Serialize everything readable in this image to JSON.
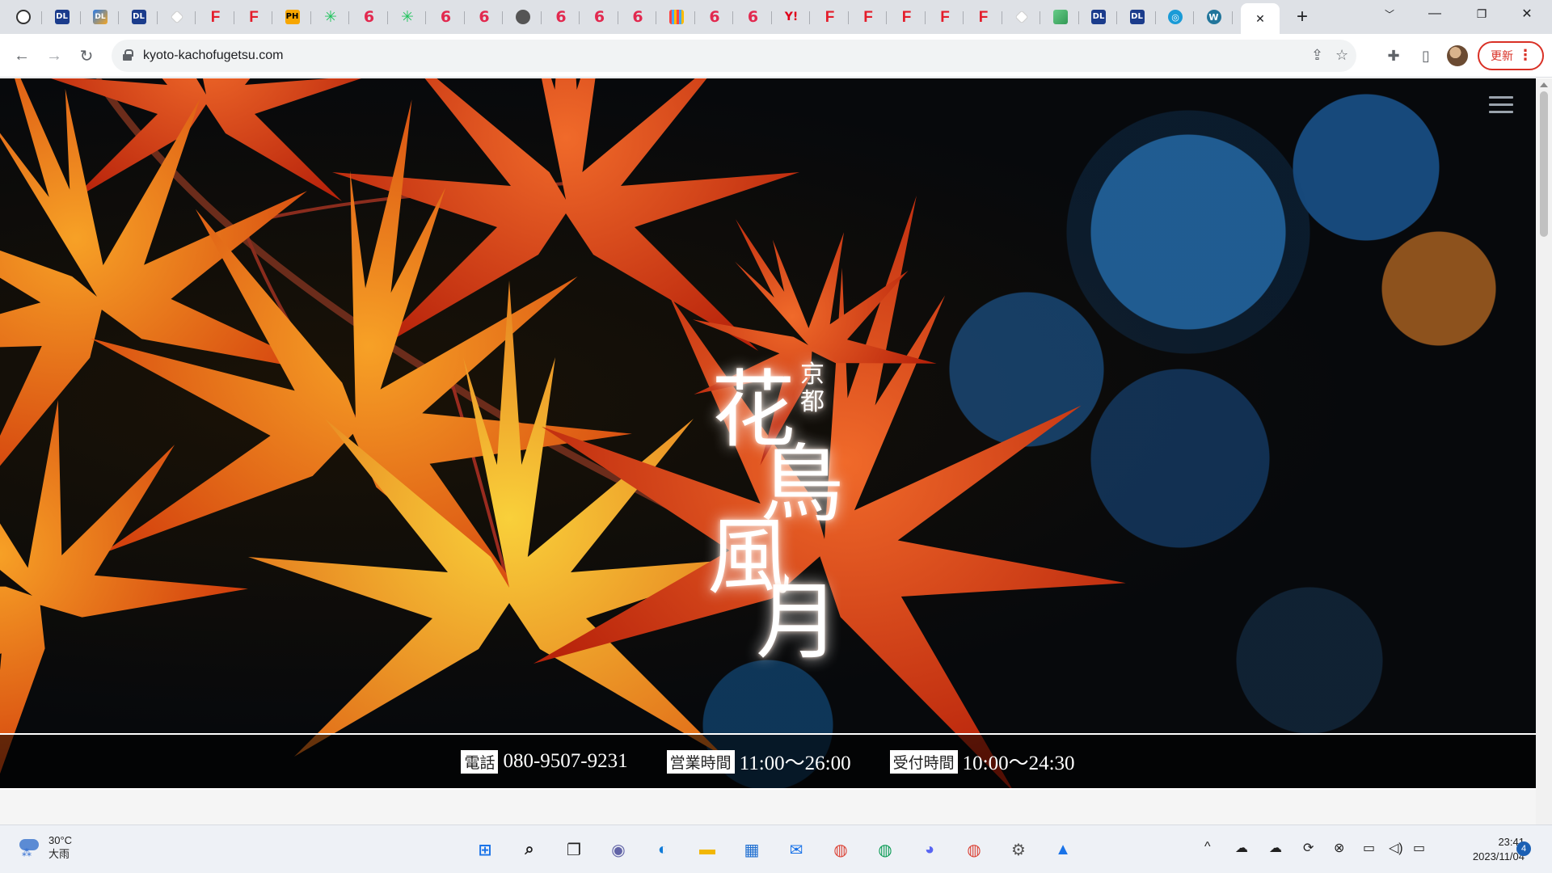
{
  "browser": {
    "tabs": [
      {
        "icon": "github-icon",
        "kind": "gh",
        "glyph": ""
      },
      {
        "icon": "dl-icon",
        "kind": "dl",
        "glyph": "DL"
      },
      {
        "icon": "dl-color-icon",
        "kind": "dlc",
        "glyph": "DL"
      },
      {
        "icon": "dl-icon",
        "kind": "dl",
        "glyph": "DL"
      },
      {
        "icon": "diamond-icon",
        "kind": "diamond",
        "glyph": ""
      },
      {
        "icon": "fanza-icon",
        "kind": "f",
        "glyph": "F"
      },
      {
        "icon": "fanza-icon",
        "kind": "f",
        "glyph": "F"
      },
      {
        "icon": "ph-icon",
        "kind": "ph",
        "glyph": "PH"
      },
      {
        "icon": "star-icon",
        "kind": "star",
        "glyph": "✳"
      },
      {
        "icon": "six-icon",
        "kind": "six",
        "glyph": "6"
      },
      {
        "icon": "star-icon",
        "kind": "star",
        "glyph": "✳"
      },
      {
        "icon": "six-icon",
        "kind": "six",
        "glyph": "6"
      },
      {
        "icon": "six-icon",
        "kind": "six",
        "glyph": "6"
      },
      {
        "icon": "globe-icon",
        "kind": "glob",
        "glyph": ""
      },
      {
        "icon": "six-icon",
        "kind": "six",
        "glyph": "6"
      },
      {
        "icon": "six-icon",
        "kind": "six",
        "glyph": "6"
      },
      {
        "icon": "six-icon",
        "kind": "six",
        "glyph": "6"
      },
      {
        "icon": "grid-icon",
        "kind": "grid",
        "glyph": ""
      },
      {
        "icon": "six-icon",
        "kind": "six",
        "glyph": "6"
      },
      {
        "icon": "six-icon",
        "kind": "six",
        "glyph": "6"
      },
      {
        "icon": "y-icon",
        "kind": "y",
        "glyph": "Y!"
      },
      {
        "icon": "fanza-icon",
        "kind": "f",
        "glyph": "F"
      },
      {
        "icon": "fanza-icon",
        "kind": "f",
        "glyph": "F"
      },
      {
        "icon": "fanza-icon",
        "kind": "f",
        "glyph": "F"
      },
      {
        "icon": "fanza-icon",
        "kind": "f",
        "glyph": "F"
      },
      {
        "icon": "fanza-icon",
        "kind": "f",
        "glyph": "F"
      },
      {
        "icon": "diamond-icon",
        "kind": "diamond",
        "glyph": ""
      },
      {
        "icon": "image-icon",
        "kind": "img",
        "glyph": ""
      },
      {
        "icon": "dl-icon",
        "kind": "dl",
        "glyph": "DL"
      },
      {
        "icon": "dl-icon",
        "kind": "dl",
        "glyph": "DL"
      },
      {
        "icon": "tl-icon",
        "kind": "tl",
        "glyph": "◎"
      },
      {
        "icon": "wordpress-icon",
        "kind": "wp",
        "glyph": "W"
      }
    ],
    "active_tab_close": "✕",
    "new_tab": "+",
    "url": "kyoto-kachofugetsu.com",
    "update_label": "更新"
  },
  "site": {
    "logo_small": "京都",
    "logo_chars": [
      "花",
      "鳥",
      "風",
      "月"
    ],
    "info": [
      {
        "label": "電話",
        "value": "080-9507-9231"
      },
      {
        "label": "営業時間",
        "value": "11:00〜26:00"
      },
      {
        "label": "受付時間",
        "value": "10:00〜24:30"
      }
    ]
  },
  "taskbar": {
    "temperature": "30°C",
    "weather": "大雨",
    "time": "23:41",
    "date": "2023/11/04",
    "notification_count": "4",
    "apps": [
      {
        "name": "start-icon",
        "glyph": "⊞",
        "color": "#1a73e8"
      },
      {
        "name": "search-icon",
        "glyph": "⌕",
        "color": "#202020"
      },
      {
        "name": "task-view-icon",
        "glyph": "❐",
        "color": "#202020"
      },
      {
        "name": "teams-chat-icon",
        "glyph": "◉",
        "color": "#6264a7"
      },
      {
        "name": "edge-icon",
        "glyph": "◐",
        "color": "#0f7bd8"
      },
      {
        "name": "file-explorer-icon",
        "glyph": "▬",
        "color": "#f2b705"
      },
      {
        "name": "store-icon",
        "glyph": "▦",
        "color": "#1f6fd1"
      },
      {
        "name": "mail-icon",
        "glyph": "✉",
        "color": "#1a73e8"
      },
      {
        "name": "chrome-icon",
        "glyph": "◍",
        "color": "#db4437"
      },
      {
        "name": "chrome-icon",
        "glyph": "◍",
        "color": "#0f9d58"
      },
      {
        "name": "discord-icon",
        "glyph": "◕",
        "color": "#5865f2"
      },
      {
        "name": "chrome-icon",
        "glyph": "◍",
        "color": "#db4437"
      },
      {
        "name": "settings-icon",
        "glyph": "⚙",
        "color": "#555"
      },
      {
        "name": "photos-icon",
        "glyph": "▲",
        "color": "#1a73e8"
      }
    ]
  }
}
